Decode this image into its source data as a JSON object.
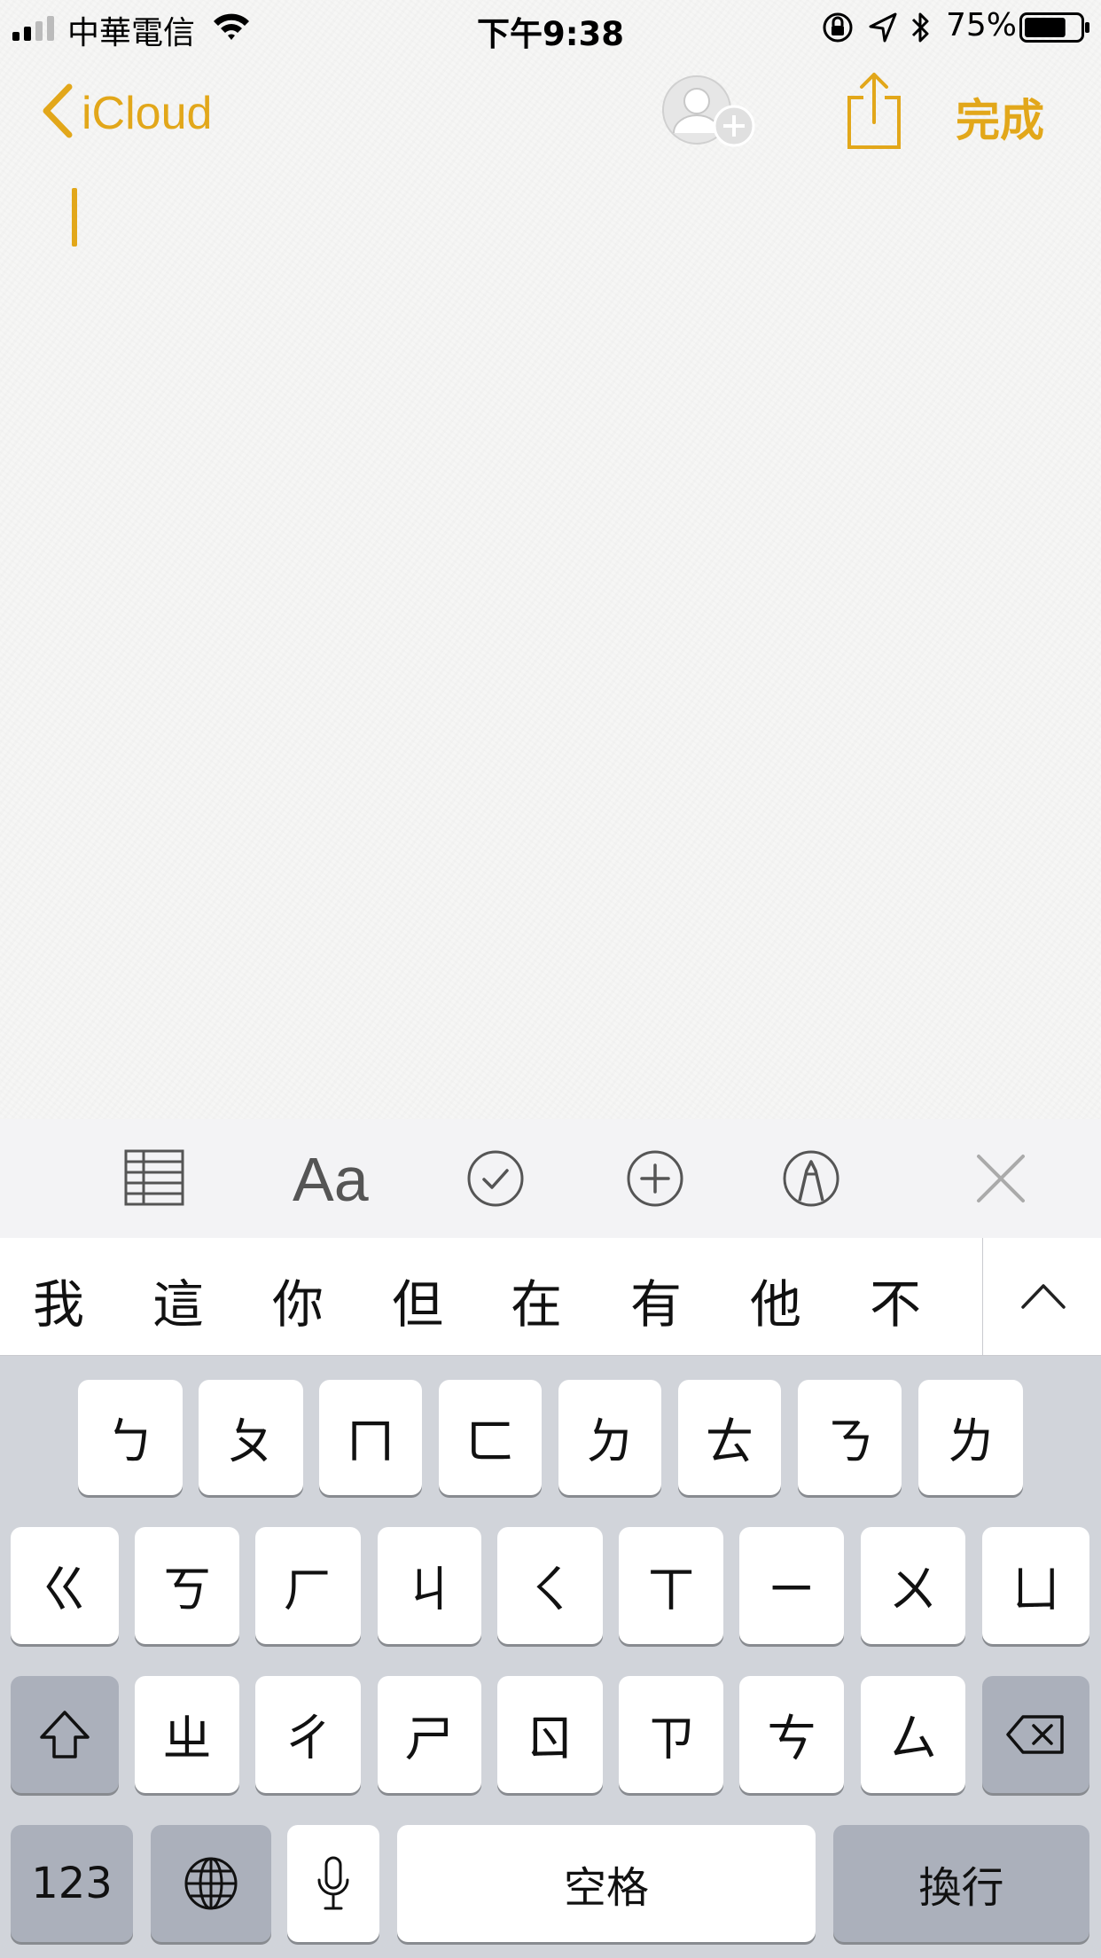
{
  "status_bar": {
    "carrier": "中華電信",
    "time": "下午9:38",
    "battery_percent": "75%",
    "battery_level": 0.75,
    "signal_bars_filled": 2,
    "signal_bars_total": 4
  },
  "nav": {
    "back_label": "iCloud",
    "done_label": "完成"
  },
  "accent_color": "#E2A71A",
  "toolbar": {
    "icons": [
      "table-icon",
      "text-format-icon",
      "checklist-icon",
      "add-icon",
      "markup-icon",
      "close-icon"
    ],
    "format_label": "Aa"
  },
  "candidates": {
    "words": [
      "我",
      "這",
      "你",
      "但",
      "在",
      "有",
      "他",
      "不"
    ]
  },
  "keyboard": {
    "row1": [
      "ㄅ",
      "ㄆ",
      "ㄇ",
      "ㄈ",
      "ㄉ",
      "ㄊ",
      "ㄋ",
      "ㄌ"
    ],
    "row2": [
      "ㄍ",
      "ㄎ",
      "ㄏ",
      "ㄐ",
      "ㄑ",
      "ㄒ",
      "ㄧ",
      "ㄨ",
      "ㄩ"
    ],
    "row3": [
      "ㄓ",
      "ㄔ",
      "ㄕ",
      "ㄖ",
      "ㄗ",
      "ㄘ",
      "ㄙ"
    ],
    "numbers_label": "123",
    "space_label": "空格",
    "return_label": "換行"
  }
}
